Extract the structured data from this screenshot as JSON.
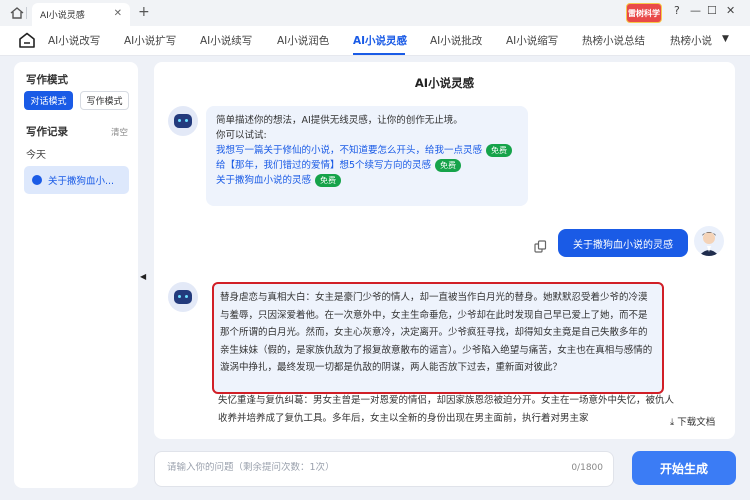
{
  "window": {
    "tab_title": "AI小说灵感",
    "tab_close": "✕",
    "new_tab": "+",
    "brand_badge": "雷树科学",
    "controls": [
      "?",
      "—",
      "☐",
      "✕"
    ]
  },
  "nav": {
    "items": [
      "AI小说改写",
      "AI小说扩写",
      "AI小说续写",
      "AI小说润色",
      "AI小说灵感",
      "AI小说批改",
      "AI小说缩写",
      "热榜小说总结",
      "热榜小说"
    ],
    "active_index": 4,
    "more": "▼"
  },
  "sidebar": {
    "mode_heading": "写作模式",
    "modes": [
      "对话模式",
      "写作模式"
    ],
    "active_mode": "对话模式",
    "history_heading": "写作记录",
    "clear": "清空",
    "today": "今天",
    "history_item": "关于撒狗血小..."
  },
  "main": {
    "title": "AI小说灵感",
    "intro_line1": "简单描述你的想法，AI提供无线灵感，让你的创作无止境。",
    "intro_line2": "你可以试试:",
    "suggestions": [
      {
        "text": "我想写一篇关于修仙的小说，不知道要怎么开头，给我一点灵感",
        "tag": "免费"
      },
      {
        "text": "给【那年，我们错过的爱情】想5个续写方向的灵感",
        "tag": "免费"
      },
      {
        "text": "关于撒狗血小说的灵感",
        "tag": "免费"
      }
    ],
    "user_message": "关于撒狗血小说的灵感",
    "answer_highlight": "替身虐恋与真相大白：女主是豪门少爷的情人，却一直被当作白月光的替身。她默默忍受着少爷的冷漠与羞辱，只因深爱着他。在一次意外中，女主生命垂危，少爷却在此时发现自己早已爱上了她，而不是那个所谓的白月光。然而，女主心灰意冷，决定离开。少爷疯狂寻找，却得知女主竟是自己失散多年的亲生妹妹（假的，是家族仇敌为了报复故意散布的谣言）。少爷陷入绝望与痛苦，女主也在真相与感情的漩涡中挣扎，最终发现一切都是仇敌的阴谋，两人能否放下过去，重新面对彼此？",
    "answer_next": "失忆重逢与复仇纠葛：男女主曾是一对恩爱的情侣，却因家族恩怨被迫分开。女主在一场意外中失忆，被仇人收养并培养成了复仇工具。多年后，女主以全新的身份出现在男主面前，执行着对男主家",
    "download": "下载文档"
  },
  "input": {
    "placeholder": "请输入你的问题（剩余提问次数：1次）",
    "counter": "0/1800",
    "generate": "开始生成"
  },
  "colors": {
    "accent": "#1a5be6",
    "free_tag": "#16a34a",
    "highlight_border": "#d11f27"
  }
}
